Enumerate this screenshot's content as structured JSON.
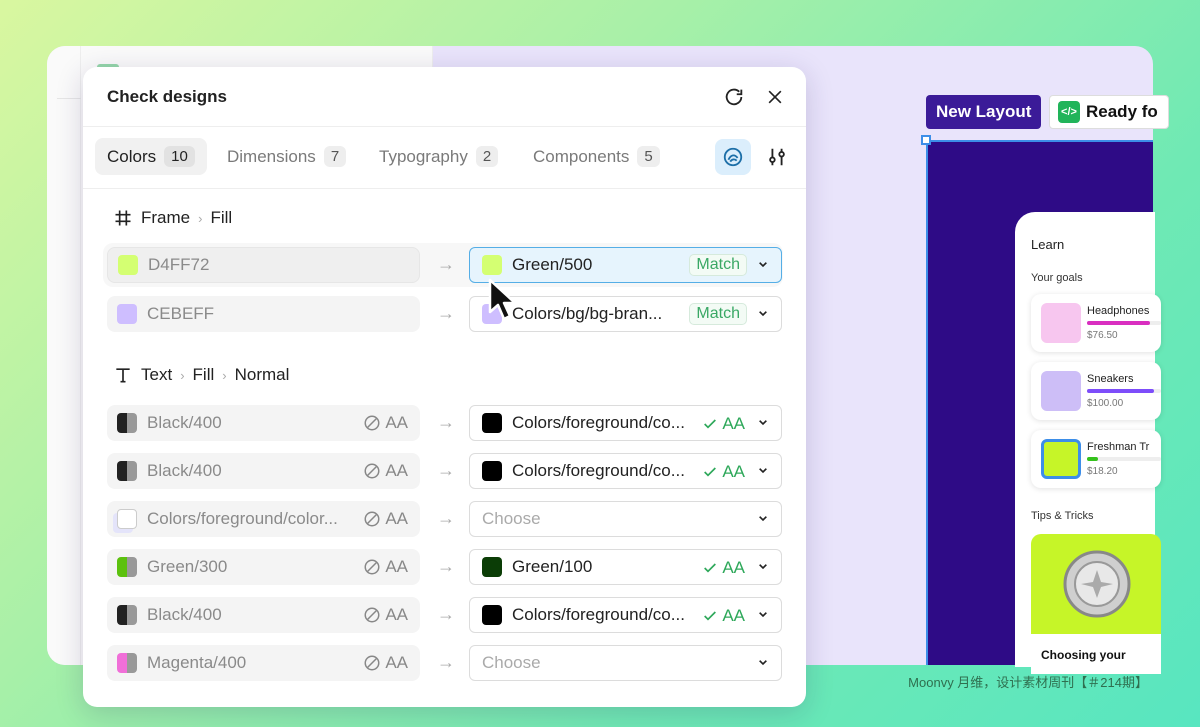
{
  "dialog": {
    "title": "Check designs",
    "tabs": [
      {
        "label": "Colors",
        "count": "10"
      },
      {
        "label": "Dimensions",
        "count": "7"
      },
      {
        "label": "Typography",
        "count": "2"
      },
      {
        "label": "Components",
        "count": "5"
      }
    ],
    "sections": [
      {
        "icon": "frame-icon",
        "crumbs": [
          "Frame",
          "Fill"
        ]
      },
      {
        "icon": "text-icon",
        "crumbs": [
          "Text",
          "Fill",
          "Normal"
        ]
      }
    ],
    "fill_rows": [
      {
        "source": "D4FF72",
        "swatch": "#d4ff72",
        "target": "Green/500",
        "target_swatch": "#d4ff72",
        "status": "Match"
      },
      {
        "source": "CEBEFF",
        "swatch": "#cebeff",
        "target": "Colors/bg/bg-bran...",
        "target_swatch": "#cebeff",
        "status": "Match"
      }
    ],
    "text_rows": [
      {
        "source": "Black/400",
        "aa": "AA",
        "target": "Colors/foreground/co...",
        "target_aa": "AA",
        "swatch": "#222222",
        "target_swatch": "#000000"
      },
      {
        "source": "Black/400",
        "aa": "AA",
        "target": "Colors/foreground/co...",
        "target_aa": "AA",
        "swatch": "#222222",
        "target_swatch": "#000000"
      },
      {
        "source": "Colors/foreground/color...",
        "aa": "AA",
        "target": "Choose",
        "target_aa": "",
        "swatch": "#ffffff",
        "target_swatch": ""
      },
      {
        "source": "Green/300",
        "aa": "AA",
        "target": "Green/100",
        "target_aa": "AA",
        "swatch": "#5cc10e",
        "target_swatch": "#0b3d06"
      },
      {
        "source": "Black/400",
        "aa": "AA",
        "target": "Colors/foreground/co...",
        "target_aa": "AA",
        "swatch": "#222222",
        "target_swatch": "#000000"
      },
      {
        "source": "Magenta/400",
        "aa": "AA",
        "target": "Choose",
        "target_aa": "",
        "swatch": "#f06fd8",
        "target_swatch": ""
      }
    ]
  },
  "canvas": {
    "new_layout": "New Layout",
    "ready": "Ready fo",
    "phone": {
      "title": "Learn",
      "goals_label": "Your goals",
      "goals": [
        {
          "name": "Headphones",
          "price": "$76.50",
          "progress": 0.85,
          "bar_color": "#d92ec0",
          "img": "#f7c6ef"
        },
        {
          "name": "Sneakers",
          "price": "$100.00",
          "progress": 0.9,
          "bar_color": "#7d4dfa",
          "img": "#cdbef7"
        },
        {
          "name": "Freshman Tr",
          "price": "$18.20",
          "progress": 0.15,
          "bar_color": "#35c21c",
          "img": "#c6f528"
        }
      ],
      "tips_label": "Tips & Tricks",
      "tip_caption": "Choosing your"
    }
  },
  "watermark": "Moonvy 月维，设计素材周刊【＃214期】"
}
